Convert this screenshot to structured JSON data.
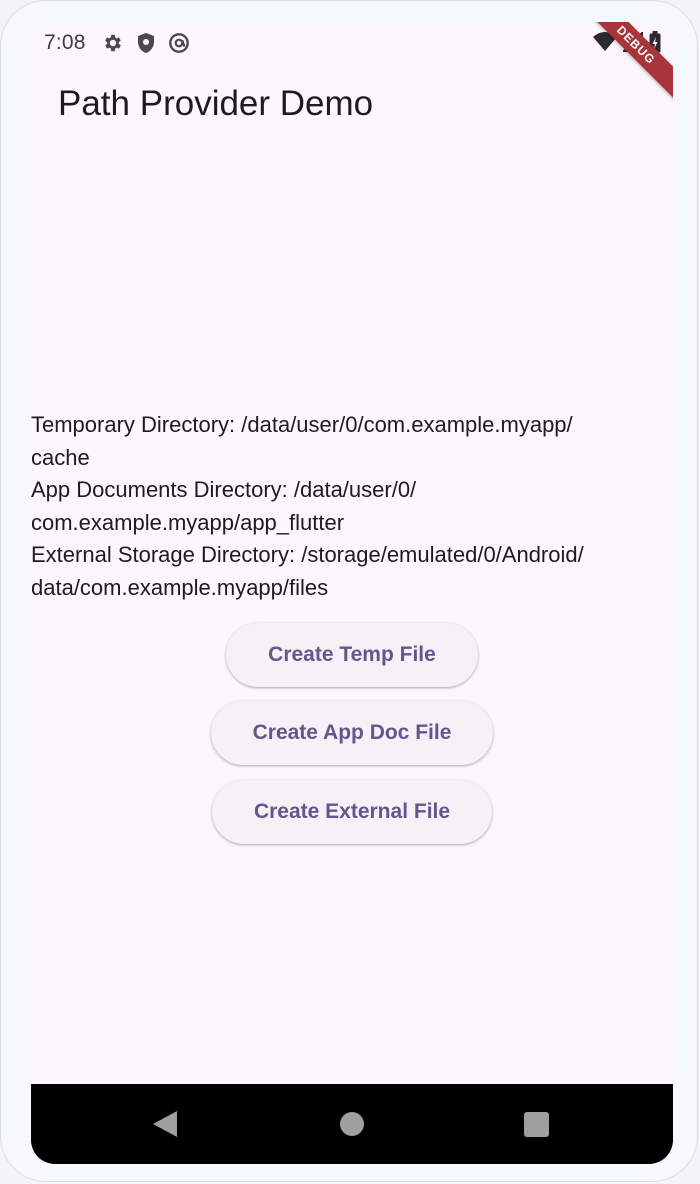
{
  "status_bar": {
    "time": "7:08",
    "left_icons": [
      "gear-icon",
      "shield-icon",
      "at-sign-icon"
    ],
    "right_icons": [
      "wifi-icon",
      "signal-icon",
      "battery-icon"
    ]
  },
  "debug_banner": "DEBUG",
  "app_bar": {
    "title": "Path Provider Demo"
  },
  "directories": {
    "lines": [
      "Temporary Directory: /data/user/0/com.example.myapp/",
      "cache",
      "App Documents Directory: /data/user/0/",
      "com.example.myapp/app_flutter",
      "External Storage Directory: /storage/emulated/0/Android/",
      "data/com.example.myapp/files"
    ]
  },
  "buttons": {
    "create_temp": "Create Temp File",
    "create_app_doc": "Create App Doc File",
    "create_external": "Create External File"
  },
  "nav_bar": {
    "icons": [
      "back-icon",
      "home-icon",
      "recent-apps-icon"
    ]
  },
  "colors": {
    "screen_background": "#fdf7fd",
    "button_text": "#65558f",
    "button_background": "#f6f1f7",
    "debug_ribbon": "#a8353a",
    "nav_bar": "#000000"
  }
}
